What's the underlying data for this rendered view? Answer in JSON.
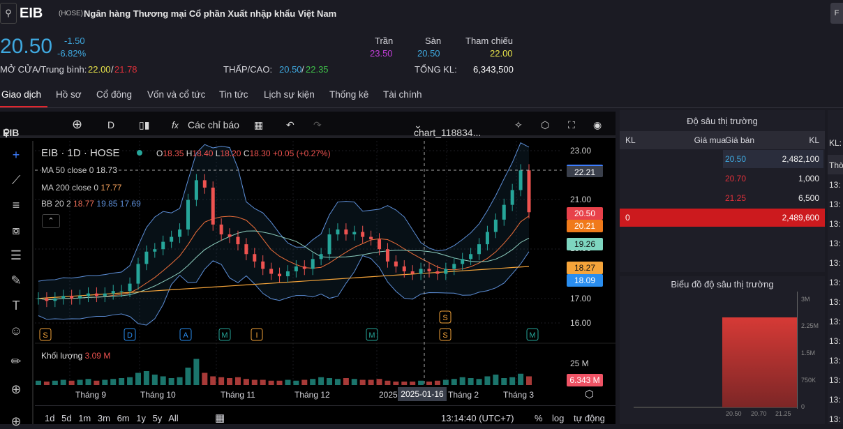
{
  "header": {
    "ticker": "EIB",
    "exchange": "(HOSE)",
    "company": "Ngân hàng Thương mại Cổ phần Xuất nhập khẩu Việt Nam",
    "price": "20.50",
    "change": "-1.50",
    "change_pct": "-6.82%",
    "open_avg_label": "MỞ CỬA/Trung bình:",
    "open": "22.00",
    "avg": "21.78",
    "lowhigh_label": "THẤP/CAO:",
    "low": "20.50",
    "high": "22.35",
    "ceiling_label": "Trần",
    "ceiling": "23.50",
    "floor_label": "Sàn",
    "floor": "20.50",
    "ref_label": "Tham chiếu",
    "ref": "22.00",
    "total_vol_label": "TỔNG KL:",
    "total_vol": "6,343,500",
    "corner_button": "F"
  },
  "tabs": [
    "Giao dịch",
    "Hồ sơ",
    "Cổ đông",
    "Vốn và cổ tức",
    "Tin tức",
    "Lịch sự kiện",
    "Thống kê",
    "Tài chính"
  ],
  "toolbar": {
    "symbol": "EIB",
    "interval": "D",
    "indicators": "Các chỉ báo",
    "chart_name": "chart_118834..."
  },
  "legend": {
    "title": "EIB · 1D · HOSE",
    "o_label": "O",
    "o": "18.35",
    "h_label": "H",
    "h": "18.40",
    "l_label": "L",
    "l": "18.20",
    "c_label": "C",
    "c": "18.30",
    "chg": "+0.05 (+0.27%)",
    "ma50": "MA 50 close 0",
    "ma50_val": "18.73",
    "ma200": "MA 200 close 0",
    "ma200_val": "17.77",
    "bb": "BB 20 2",
    "bb_mid": "18.77",
    "bb_up": "19.85",
    "bb_low": "17.69",
    "volume_label": "Khối lượng",
    "volume_val": "3.09 M"
  },
  "price_axis": [
    "23.00",
    "21.00",
    "19.00",
    "17.00",
    "16.00"
  ],
  "price_labels": {
    "crosshair": "22.21",
    "last": "20.50",
    "ma": "20.21",
    "bb_up": "19.26",
    "bb_mid": "18.27",
    "bb_low": "18.09"
  },
  "volume_axis": "25 M",
  "volume_last": "6.343 M",
  "time_axis": [
    "Tháng 9",
    "Tháng 10",
    "Tháng 11",
    "Tháng 12",
    "2025",
    "Tháng 2",
    "Tháng 3"
  ],
  "crosshair_date": "2025-01-16",
  "events": [
    "S",
    "D",
    "A",
    "M",
    "I",
    "M",
    "S",
    "S",
    "M"
  ],
  "ranges": [
    "1d",
    "5d",
    "1m",
    "3m",
    "6m",
    "1y",
    "5y",
    "All"
  ],
  "clock": "13:14:40 (UTC+7)",
  "scale_opts": [
    "%",
    "log",
    "tự động"
  ],
  "colors": {
    "up": "#26a69a",
    "down": "#ef5350",
    "accent": "#e0262e"
  },
  "closes": [
    17.0,
    16.9,
    17.0,
    17.1,
    17.0,
    17.1,
    17.2,
    17.1,
    17.2,
    17.3,
    17.3,
    17.6,
    18.4,
    18.9,
    19.0,
    19.3,
    19.5,
    19.8,
    21.0,
    21.8,
    21.5,
    20.0,
    19.6,
    19.5,
    19.2,
    18.8,
    18.5,
    18.2,
    18.0,
    17.9,
    18.1,
    18.3,
    18.2,
    18.6,
    18.8,
    19.6,
    19.8,
    19.6,
    19.7,
    19.5,
    19.4,
    19.0,
    18.5,
    18.3,
    18.1,
    18.0,
    18.2,
    18.1,
    18.0,
    18.2,
    18.4,
    18.6,
    18.8,
    19.2,
    19.7,
    20.2,
    20.8,
    21.4,
    22.2,
    20.5
  ],
  "volumes": [
    5,
    4,
    5,
    6,
    5,
    6,
    7,
    5,
    6,
    7,
    8,
    9,
    14,
    16,
    12,
    10,
    8,
    9,
    20,
    30,
    14,
    10,
    9,
    8,
    9,
    7,
    6,
    6,
    5,
    5,
    6,
    5,
    6,
    7,
    9,
    8,
    7,
    8,
    7,
    6,
    6,
    7,
    5,
    4,
    4,
    4,
    5,
    4,
    5,
    6,
    7,
    9,
    8,
    7,
    10,
    12,
    8,
    9,
    13,
    10
  ],
  "depth": {
    "title": "Độ sâu thị trường",
    "cols": [
      "KL",
      "Giá mua",
      "Giá bán",
      "KL"
    ],
    "asks": [
      {
        "price": "20.50",
        "vol": "2,482,100"
      },
      {
        "price": "20.70",
        "vol": "1,000"
      },
      {
        "price": "21.25",
        "vol": "6,500"
      }
    ],
    "total_bid": "0",
    "total_ask": "2,489,600"
  },
  "depth_chart": {
    "title": "Biểu đồ độ sâu thị trường",
    "y_ticks": [
      "3M",
      "2.25M",
      "1.5M",
      "750K",
      "0"
    ],
    "x_ticks": [
      "20.50",
      "20.70",
      "21.25"
    ],
    "ask_cum": 2489600
  },
  "far": {
    "kl": "KL:",
    "head": "Thờ",
    "rows": [
      "13:",
      "13:",
      "13:",
      "13:",
      "13:",
      "13:",
      "13:",
      "13:",
      "13:",
      "13:",
      "13:",
      "13:",
      "13:",
      "13:"
    ]
  }
}
